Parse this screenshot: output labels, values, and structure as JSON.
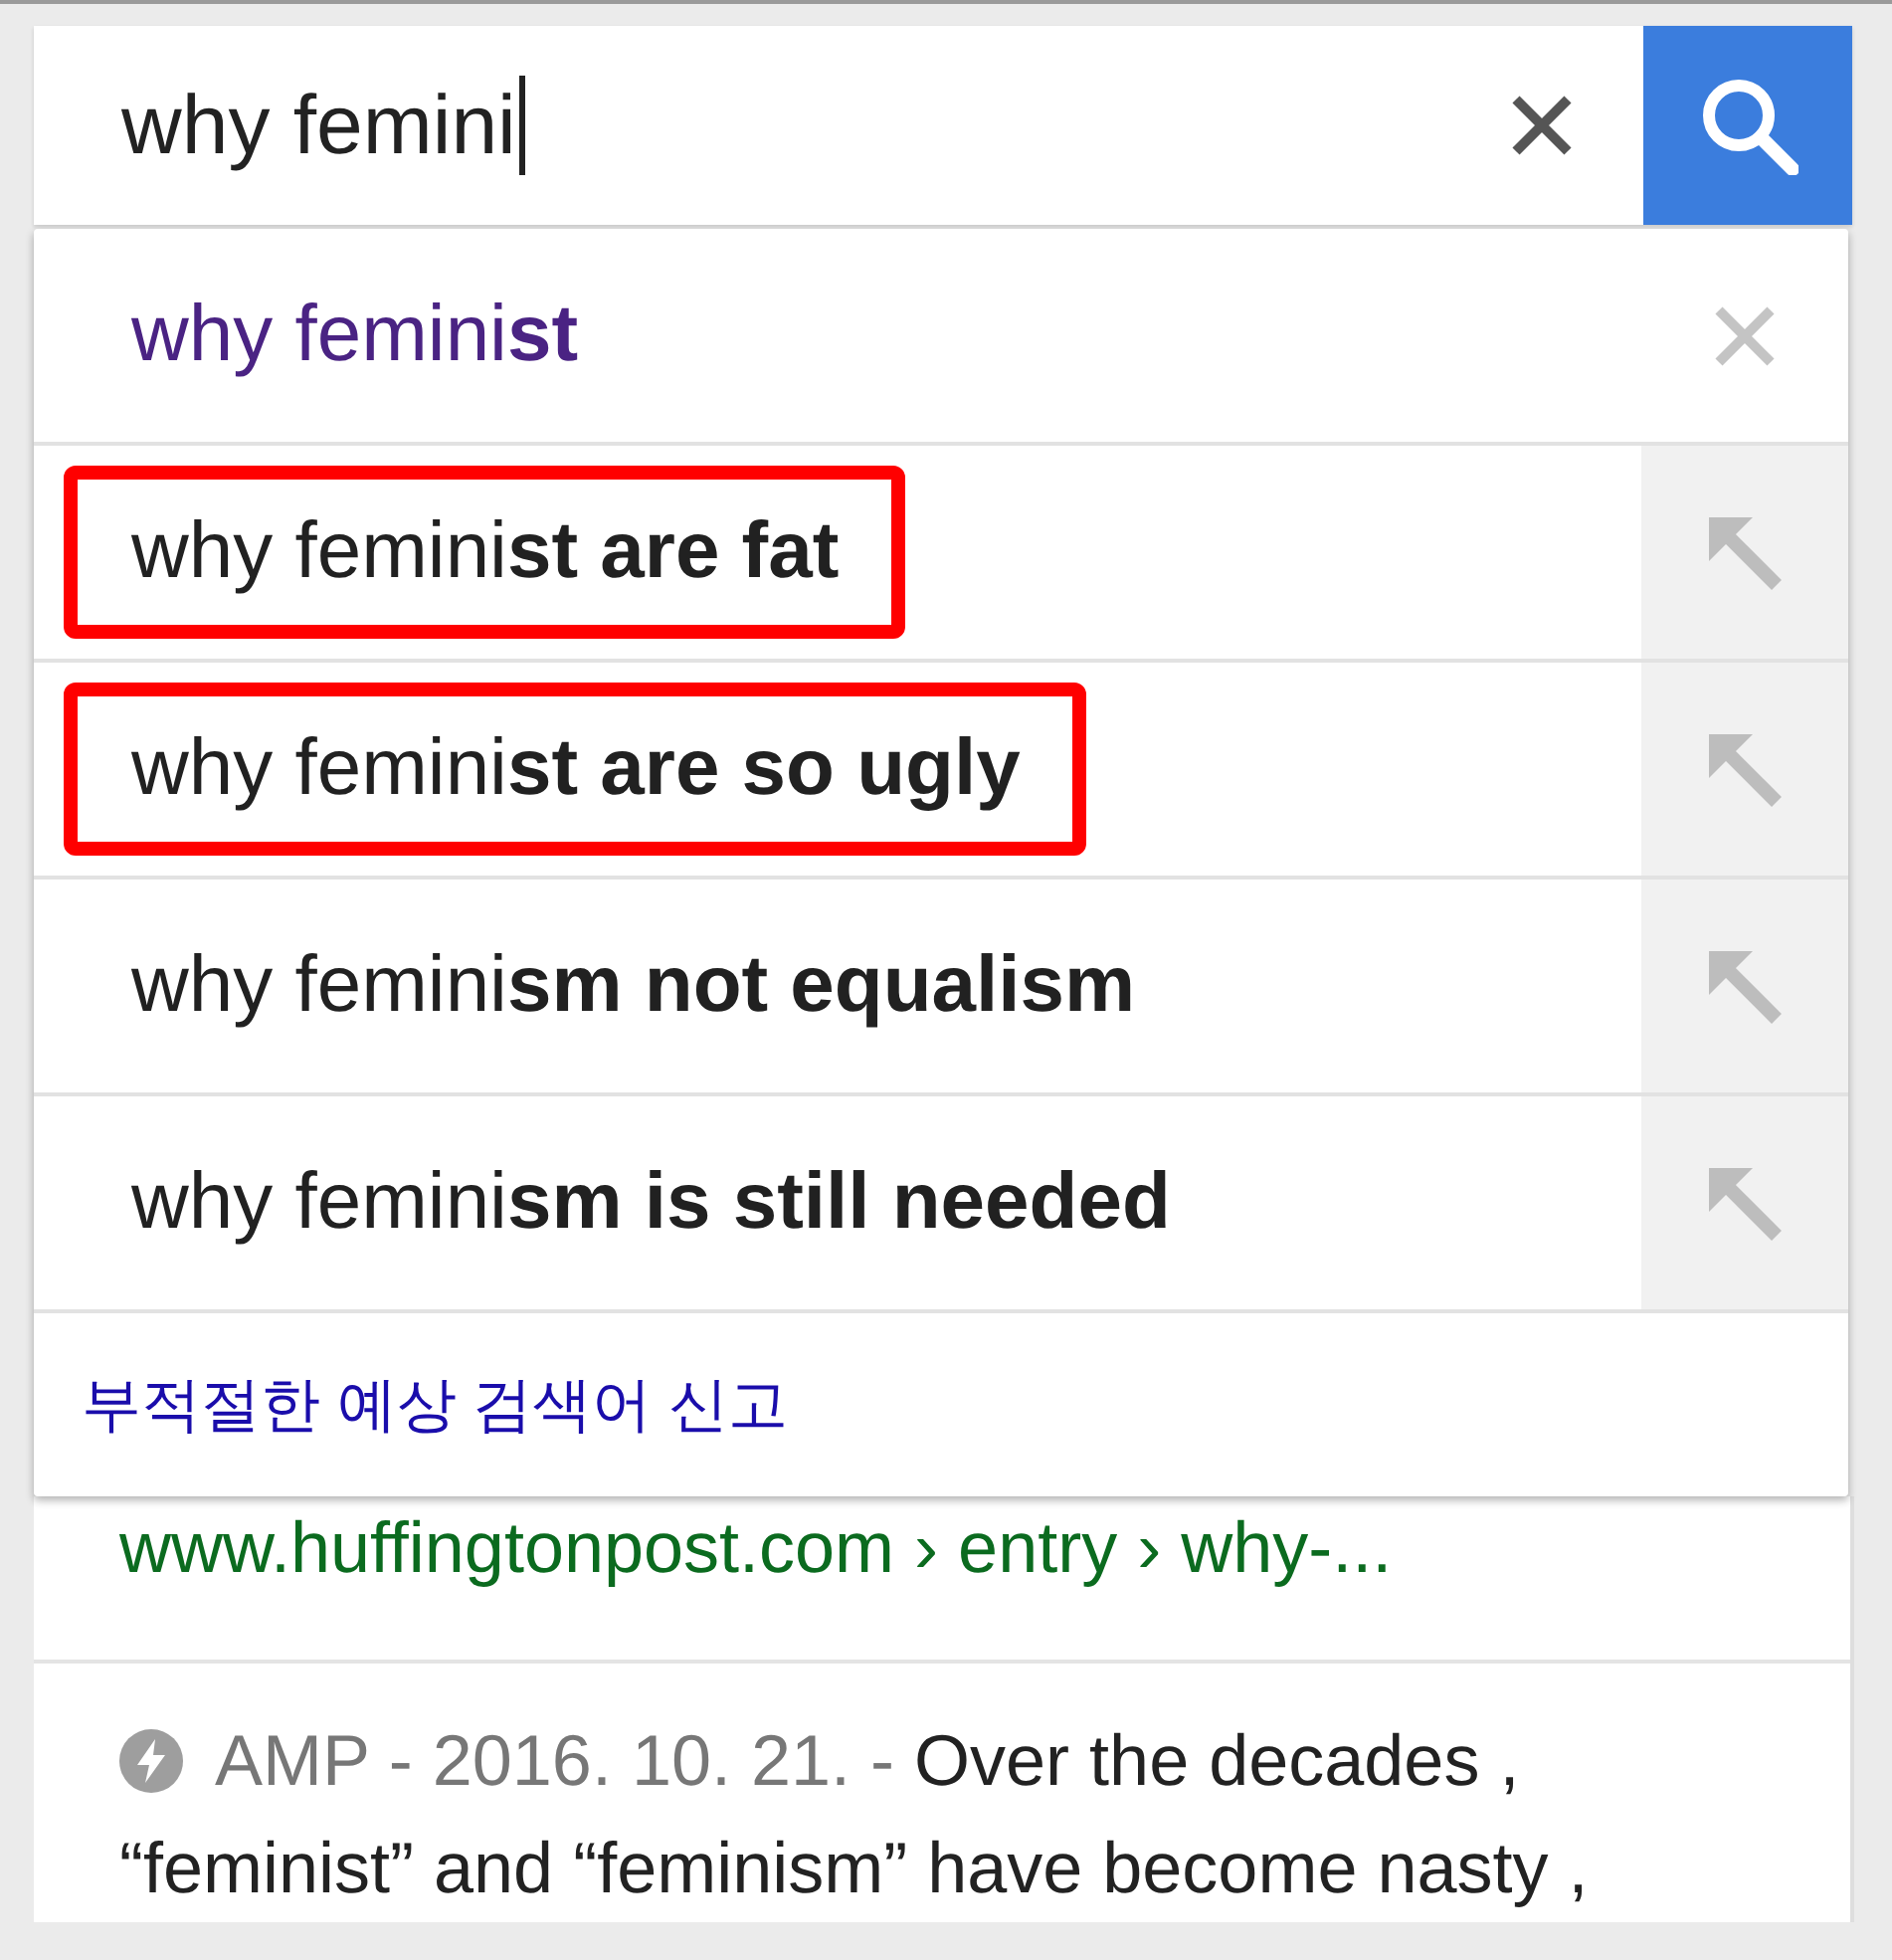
{
  "search": {
    "value": "why femini"
  },
  "suggestions": [
    {
      "kind": "history",
      "text": "why femini**st**",
      "highlighted": false
    },
    {
      "kind": "completion",
      "text": "why femini**st are fat**",
      "highlighted": true
    },
    {
      "kind": "completion",
      "text": "why femini**st are so ugly**",
      "highlighted": true
    },
    {
      "kind": "completion",
      "text": "why femini**sm not equalism**",
      "highlighted": false
    },
    {
      "kind": "completion",
      "text": "why femini**sm is still needed**",
      "highlighted": false
    }
  ],
  "report_link": "부적절한 예상 검색어 신고",
  "result": {
    "url": "www.huffingtonpost.com › entry › why-...",
    "amp_label": "AMP - 2016. 10. 21. -",
    "snippet_lines": [
      "Over the decades ,",
      "“feminist” and “feminism” have become nasty ,"
    ]
  }
}
